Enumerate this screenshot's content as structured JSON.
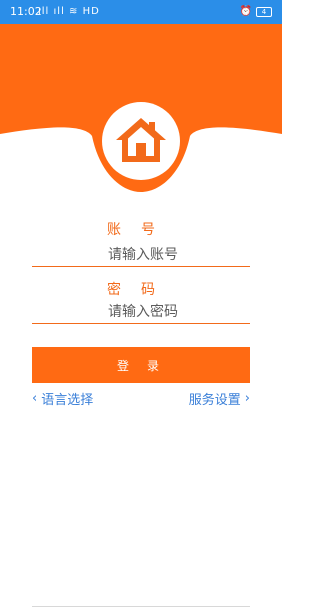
{
  "status": {
    "time": "11:02",
    "icons_text": "ıll ıll ≋ HD",
    "battery": "4"
  },
  "form": {
    "account_label": "账号",
    "account_placeholder": "请输入账号",
    "password_label": "密码",
    "password_placeholder": "请输入密码",
    "login_label": "登录"
  },
  "links": {
    "language_label": "语言选择",
    "server_label": "服务设置"
  },
  "icons": {
    "logo": "home-icon",
    "left_chevron": "chevron-left-icon",
    "right_chevron": "chevron-right-icon"
  },
  "colors": {
    "status_bar": "#2b8ee8",
    "brand_orange": "#ff6a13",
    "link_blue": "#3a7fd8"
  }
}
